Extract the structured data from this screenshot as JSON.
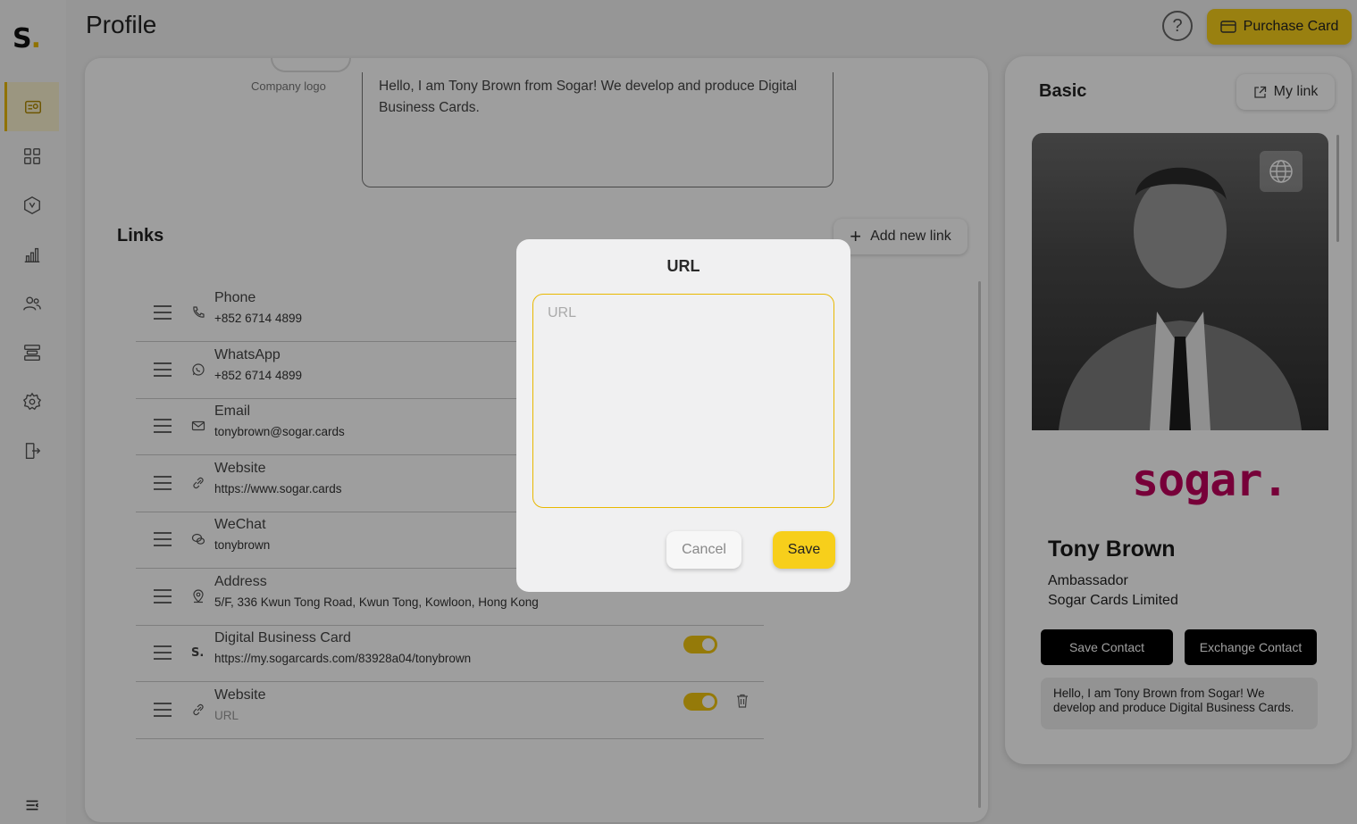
{
  "app": {
    "logo_text": "S",
    "logo_dot": ".",
    "page_title": "Profile"
  },
  "header": {
    "help_label": "?",
    "purchase_label": "Purchase Card"
  },
  "sidebar": {
    "items": [
      {
        "icon": "profile-card-icon",
        "active": true
      },
      {
        "icon": "grid-icon",
        "active": false
      },
      {
        "icon": "hexagon-icon",
        "active": false
      },
      {
        "icon": "bar-chart-icon",
        "active": false
      },
      {
        "icon": "users-icon",
        "active": false
      },
      {
        "icon": "server-icon",
        "active": false
      },
      {
        "icon": "gear-icon",
        "active": false
      },
      {
        "icon": "logout-icon",
        "active": false
      }
    ],
    "collapse_icon": "collapse-menu-icon"
  },
  "profile": {
    "company_logo_label": "Company logo",
    "bio": "Hello, I am Tony Brown from Sogar!  We develop and produce Digital Business Cards."
  },
  "links": {
    "title": "Links",
    "add_label": "Add new link",
    "items": [
      {
        "type": "Phone",
        "value": "+852 6714 4899",
        "icon": "phone-icon"
      },
      {
        "type": "WhatsApp",
        "value": "+852 6714 4899",
        "icon": "whatsapp-icon"
      },
      {
        "type": "Email",
        "value": "tonybrown@sogar.cards",
        "icon": "mail-icon"
      },
      {
        "type": "Website",
        "value": "https://www.sogar.cards",
        "icon": "link-icon"
      },
      {
        "type": "WeChat",
        "value": "tonybrown",
        "icon": "wechat-icon"
      },
      {
        "type": "Address",
        "value": "5/F, 336 Kwun Tong Road, Kwun Tong, Kowloon, Hong Kong",
        "icon": "location-icon"
      },
      {
        "type": "Digital Business Card",
        "value": "https://my.sogarcards.com/83928a04/tonybrown",
        "icon": "sogar-s-icon",
        "toggle": true
      },
      {
        "type": "Website",
        "value": "URL",
        "icon": "link-icon",
        "toggle": true,
        "deletable": true
      }
    ]
  },
  "preview": {
    "title": "Basic",
    "my_link_label": "My link",
    "brand": "sogar.",
    "name": "Tony Brown",
    "role": "Ambassador",
    "company": "Sogar Cards Limited",
    "save_contact": "Save Contact",
    "exchange_contact": "Exchange Contact",
    "bio": "Hello, I am Tony Brown from Sogar! We develop and produce Digital Business Cards."
  },
  "modal": {
    "title": "URL",
    "input_placeholder": "URL",
    "input_value": "",
    "cancel_label": "Cancel",
    "save_label": "Save"
  },
  "colors": {
    "accent": "#f7cf1b",
    "brand_magenta": "#c0005c",
    "overlay": "rgba(0,0,0,0.38)"
  }
}
